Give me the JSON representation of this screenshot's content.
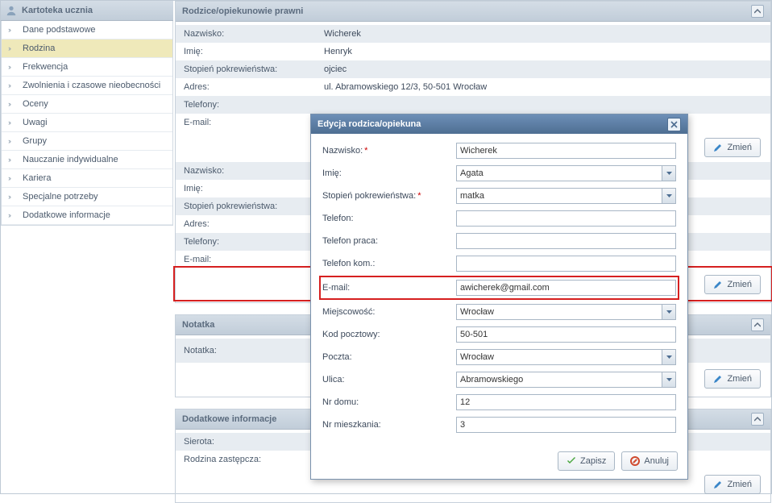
{
  "sidebar": {
    "title": "Kartoteka ucznia",
    "items": [
      {
        "label": "Dane podstawowe"
      },
      {
        "label": "Rodzina"
      },
      {
        "label": "Frekwencja"
      },
      {
        "label": "Zwolnienia i czasowe nieobecności"
      },
      {
        "label": "Oceny"
      },
      {
        "label": "Uwagi"
      },
      {
        "label": "Grupy"
      },
      {
        "label": "Nauczanie indywidualne"
      },
      {
        "label": "Kariera"
      },
      {
        "label": "Specjalne potrzeby"
      },
      {
        "label": "Dodatkowe informacje"
      }
    ],
    "active_index": 1
  },
  "panels": {
    "parents": {
      "title": "Rodzice/opiekunowie prawni",
      "fields": {
        "nazwisko_lbl": "Nazwisko:",
        "imie_lbl": "Imię:",
        "stopien_lbl": "Stopień pokrewieństwa:",
        "adres_lbl": "Adres:",
        "telefony_lbl": "Telefony:",
        "email_lbl": "E-mail:"
      },
      "parent1": {
        "nazwisko": "Wicherek",
        "imie": "Henryk",
        "stopien": "ojciec",
        "adres": "ul. Abramowskiego 12/3, 50-501 Wrocław",
        "telefony": "",
        "email": ""
      },
      "parent2": {
        "nazwisko": "",
        "imie": "",
        "stopien": "",
        "adres": "",
        "telefony": "",
        "email": ""
      }
    },
    "notatka": {
      "title": "Notatka",
      "label": "Notatka:",
      "value": ""
    },
    "dodatkowe": {
      "title": "Dodatkowe informacje",
      "sierota_lbl": "Sierota:",
      "sierota_val": "",
      "rodzina_lbl": "Rodzina zastępcza:",
      "rodzina_val": ""
    }
  },
  "buttons": {
    "zmien": "Zmień",
    "zapisz": "Zapisz",
    "anuluj": "Anuluj"
  },
  "modal": {
    "title": "Edycja rodzica/opiekuna",
    "labels": {
      "nazwisko": "Nazwisko:",
      "imie": "Imię:",
      "stopien": "Stopień pokrewieństwa:",
      "telefon": "Telefon:",
      "telefon_praca": "Telefon praca:",
      "telefon_kom": "Telefon kom.:",
      "email": "E-mail:",
      "miejscowosc": "Miejscowość:",
      "kod": "Kod pocztowy:",
      "poczta": "Poczta:",
      "ulica": "Ulica:",
      "nr_domu": "Nr domu:",
      "nr_mieszkania": "Nr mieszkania:"
    },
    "values": {
      "nazwisko": "Wicherek",
      "imie": "Agata",
      "stopien": "matka",
      "telefon": "",
      "telefon_praca": "",
      "telefon_kom": "",
      "email": "awicherek@gmail.com",
      "miejscowosc": "Wrocław",
      "kod": "50-501",
      "poczta": "Wrocław",
      "ulica": "Abramowskiego",
      "nr_domu": "12",
      "nr_mieszkania": "3"
    }
  }
}
